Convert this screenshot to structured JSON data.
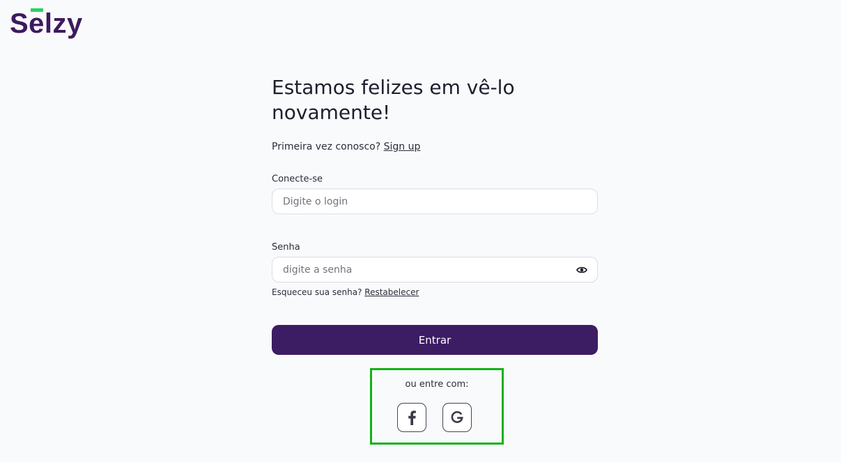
{
  "brand": {
    "logo_text": "Selzy",
    "accent_color": "#2ad160",
    "primary_color": "#3c1c63"
  },
  "heading": {
    "title_line1": "Estamos felizes em vê-lo",
    "title_line2": "novamente!"
  },
  "signup": {
    "prompt": "Primeira vez conosco?",
    "link_label": "Sign up"
  },
  "login_field": {
    "label": "Conecte-se",
    "placeholder": "Digite o login",
    "value": ""
  },
  "password_field": {
    "label": "Senha",
    "placeholder": "digite a senha",
    "value": "",
    "toggle_icon": "eye-icon"
  },
  "forgot": {
    "prompt": "Esqueceu sua senha?",
    "link_label": "Restabelecer"
  },
  "submit": {
    "label": "Entrar"
  },
  "social": {
    "label": "ou entre com:",
    "providers": [
      {
        "name": "facebook",
        "icon": "facebook-icon"
      },
      {
        "name": "google",
        "icon": "google-icon"
      }
    ],
    "highlight_color": "#13b214"
  }
}
